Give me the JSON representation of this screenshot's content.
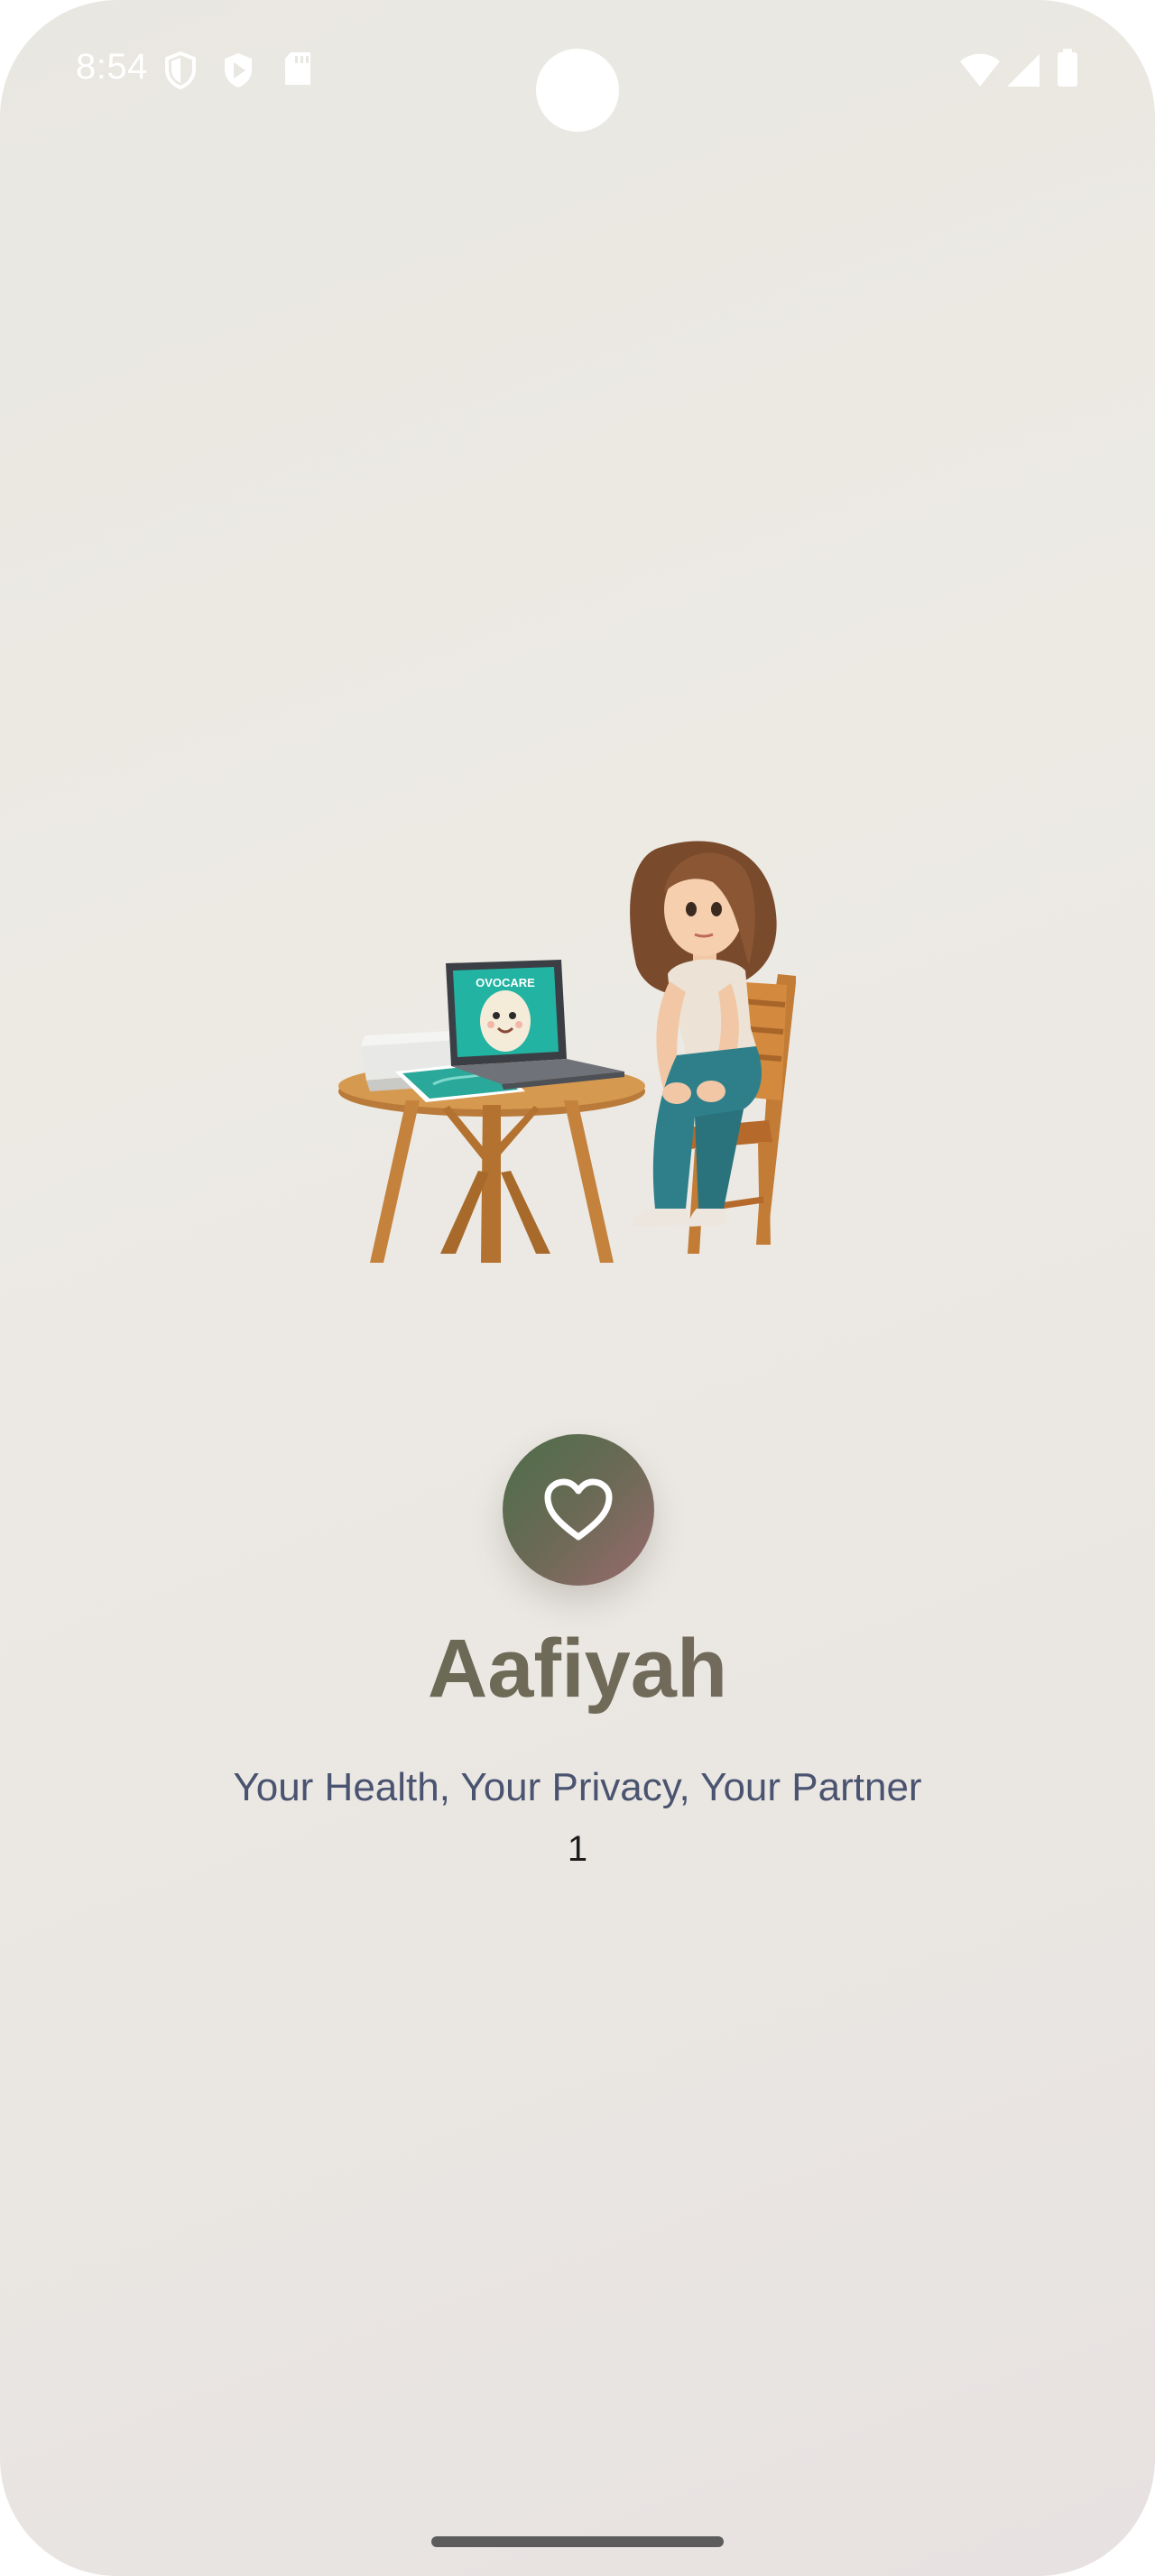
{
  "status_bar": {
    "time": "8:54",
    "icons": [
      "shield-icon",
      "play-store-icon",
      "sd-card-icon",
      "wifi-icon",
      "cellular-signal-icon",
      "battery-icon"
    ]
  },
  "illustration": {
    "screen_text": "OVOCARE"
  },
  "app": {
    "logo_icon": "heart-icon",
    "title": "Aafiyah",
    "tagline": "Your Health, Your Privacy, Your Partner",
    "counter": "1"
  },
  "colors": {
    "logo_start": "#4e6e4a",
    "logo_end": "#9a6a6e",
    "title": "#6a6a55",
    "tagline": "#4a5470"
  }
}
